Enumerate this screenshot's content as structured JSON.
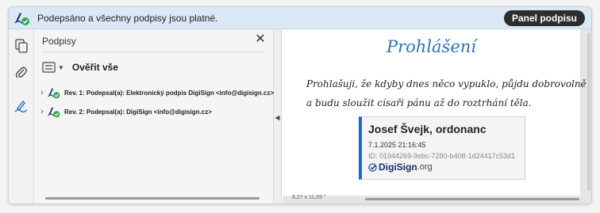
{
  "status_bar": {
    "text": "Podepsáno a všechny podpisy jsou platné.",
    "panel_button": "Panel podpisu",
    "icon": "signature-valid-icon",
    "background": "#dbe8f6"
  },
  "toolbar": {
    "items": [
      {
        "icon": "pages-icon"
      },
      {
        "icon": "attachment-icon"
      },
      {
        "icon": "signature-pen-icon"
      }
    ]
  },
  "signatures_panel": {
    "title": "Podpisy",
    "close_icon": "close-icon",
    "verify_all": "Ověřit vše",
    "items": [
      {
        "label": "Rev. 1: Podepsal(a): Elektronický podpis DigiSign <info@digisign.cz>",
        "icon": "signature-valid-icon"
      },
      {
        "label": "Rev. 2: Podepsal(a): DigiSign <info@digisign.cz>",
        "icon": "signature-valid-icon"
      }
    ]
  },
  "document": {
    "heading": "Prohlášení",
    "lines": [
      "Prohlašuji, že kdyby dnes něco vypuklo, půjdu dobrovolně",
      "a budu sloužit císaři pánu až do roztrhání těla."
    ],
    "signature_box": {
      "signer": "Josef Švejk, ordonanc",
      "date": "7.1.2025 21:16:45",
      "id": "ID: 01944269-9ebc-7280-b408-1d24417c53d1",
      "brand_main": "DigiSign",
      "brand_suffix": ".org"
    },
    "page_size": "8,27 x 11,69 \""
  },
  "colors": {
    "accent": "#2f73b8",
    "valid_green": "#2fa84f",
    "brand_blue": "#1a66c9"
  }
}
